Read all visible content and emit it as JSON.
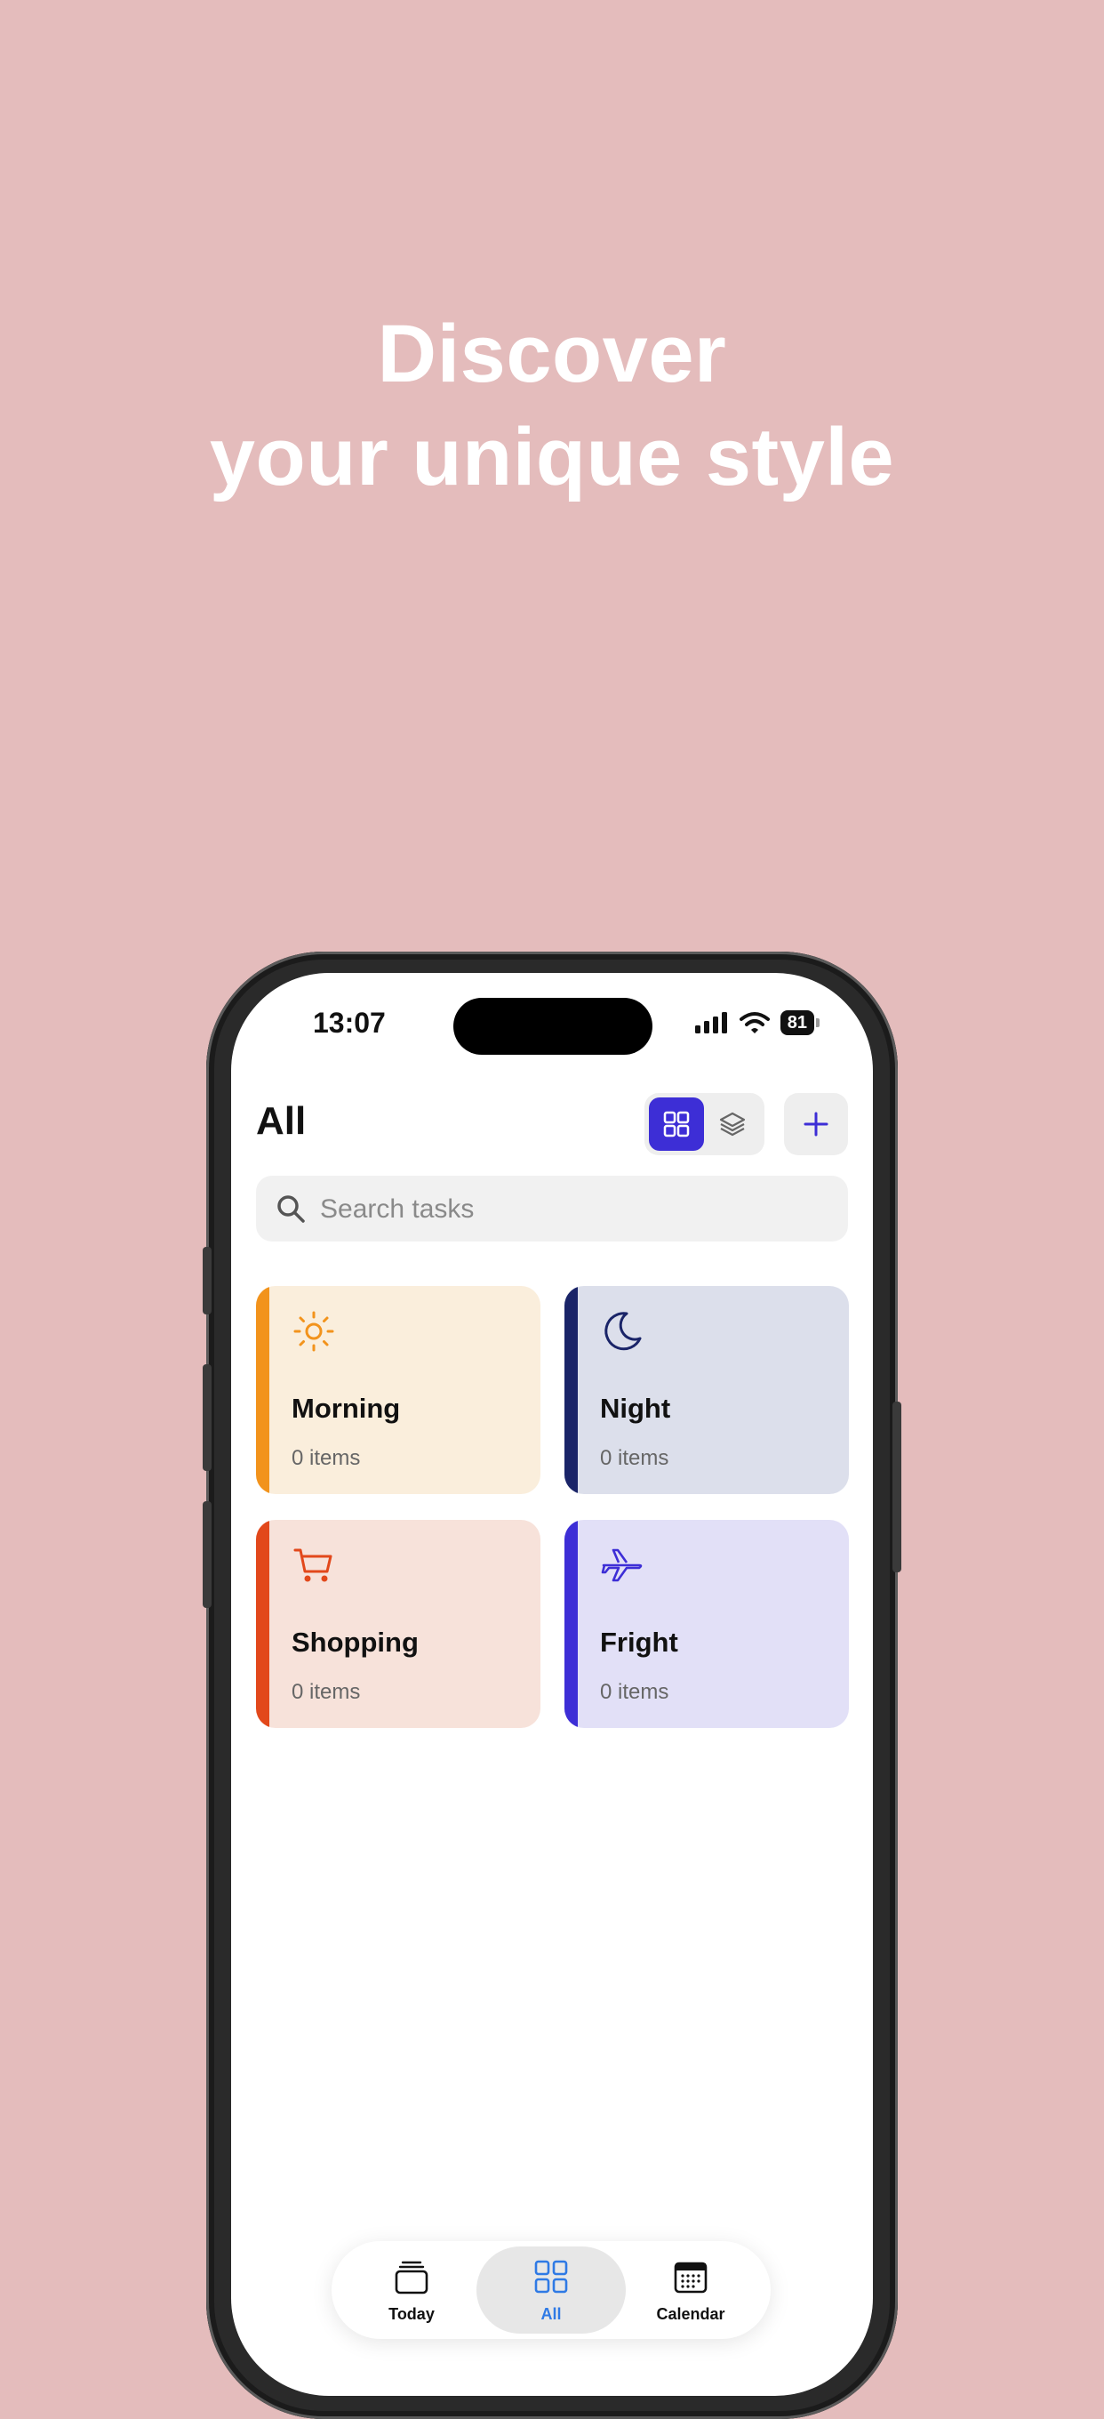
{
  "headline": {
    "line1": "Discover",
    "line2": "your unique style"
  },
  "status_bar": {
    "time": "13:07",
    "battery": "81"
  },
  "header": {
    "title": "All"
  },
  "search": {
    "placeholder": "Search tasks"
  },
  "cards": [
    {
      "name": "Morning",
      "count": "0 items",
      "icon": "sun-icon",
      "bg": "#FAEEDC",
      "accent": "#F2931C"
    },
    {
      "name": "Night",
      "count": "0 items",
      "icon": "moon-icon",
      "bg": "#DCDFEB",
      "accent": "#1A2468"
    },
    {
      "name": "Shopping",
      "count": "0 items",
      "icon": "cart-icon",
      "bg": "#F7E2DA",
      "accent": "#E2481B"
    },
    {
      "name": "Fright",
      "count": "0 items",
      "icon": "airplane-icon",
      "bg": "#E2E0F7",
      "accent": "#3D2ED6"
    }
  ],
  "tabbar": {
    "tabs": [
      {
        "label": "Today",
        "icon": "stack-icon",
        "active": false
      },
      {
        "label": "All",
        "icon": "grid-icon",
        "active": true
      },
      {
        "label": "Calendar",
        "icon": "calendar-icon",
        "active": false
      }
    ]
  },
  "colors": {
    "background": "#E4BCBC",
    "accent": "#3D2ED6",
    "active_tab": "#2F7AE5"
  }
}
